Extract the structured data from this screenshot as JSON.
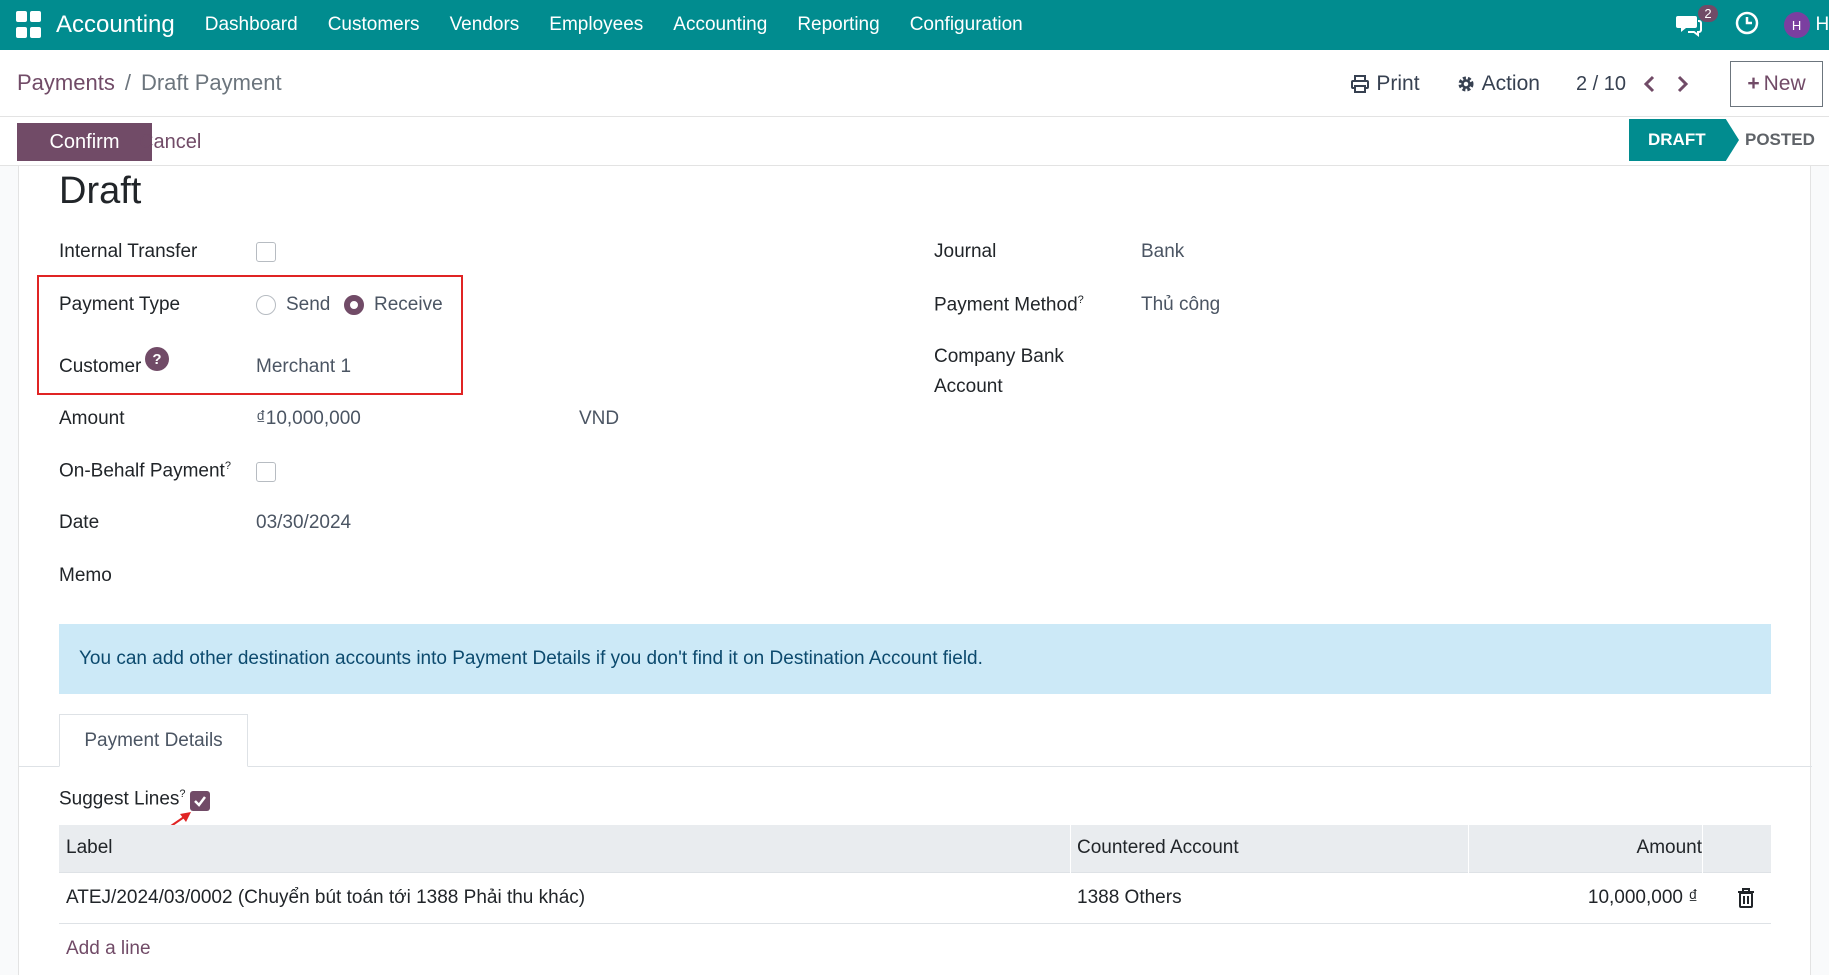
{
  "app": {
    "title": "Accounting",
    "user_initial": "H",
    "user_name": "HR",
    "messages_count": "2"
  },
  "nav": {
    "items": [
      "Dashboard",
      "Customers",
      "Vendors",
      "Employees",
      "Accounting",
      "Reporting",
      "Configuration"
    ]
  },
  "breadcrumb": {
    "parent": "Payments",
    "separator": "/",
    "current": "Draft Payment"
  },
  "control_panel": {
    "print_label": "Print",
    "action_label": "Action",
    "pager": "2 / 10",
    "new_label": "New"
  },
  "status_bar": {
    "confirm_label": "Confirm",
    "cancel_label": "Cancel",
    "stages": [
      "DRAFT",
      "POSTED"
    ],
    "active_stage": "DRAFT"
  },
  "form": {
    "title": "Draft",
    "internal_transfer_label": "Internal Transfer",
    "internal_transfer_checked": false,
    "payment_type_label": "Payment Type",
    "payment_type_options": [
      "Send",
      "Receive"
    ],
    "payment_type_selected": "Receive",
    "customer_label": "Customer",
    "customer_value": "Merchant 1",
    "amount_label": "Amount",
    "amount_value": "₫10,000,000",
    "currency": "VND",
    "on_behalf_label": "On-Behalf Payment",
    "on_behalf_checked": false,
    "date_label": "Date",
    "date_value": "03/30/2024",
    "memo_label": "Memo",
    "journal_label": "Journal",
    "journal_value": "Bank",
    "payment_method_label": "Payment Method",
    "payment_method_value": "Thủ công",
    "company_bank_label_1": "Company Bank",
    "company_bank_label_2": "Account",
    "help_mark": "?"
  },
  "alert": {
    "text": "You can add other destination accounts into Payment Details if you don't find it on Destination Account field."
  },
  "tabs": {
    "payment_details": "Payment Details"
  },
  "details": {
    "suggest_lines_label": "Suggest Lines",
    "suggest_lines_checked": true,
    "columns": [
      "Label",
      "Countered Account",
      "Amount"
    ],
    "rows": [
      {
        "label": "ATEJ/2024/03/0002 (Chuyển bút toán tới 1388 Phải thu khác)",
        "account": "1388 Others",
        "amount": "10,000,000 ₫"
      }
    ],
    "add_line": "Add a line"
  },
  "colors": {
    "navbar": "#018c8f",
    "primary": "#714b67",
    "alert_bg": "#cce9f7",
    "highlight": "#e02424"
  }
}
